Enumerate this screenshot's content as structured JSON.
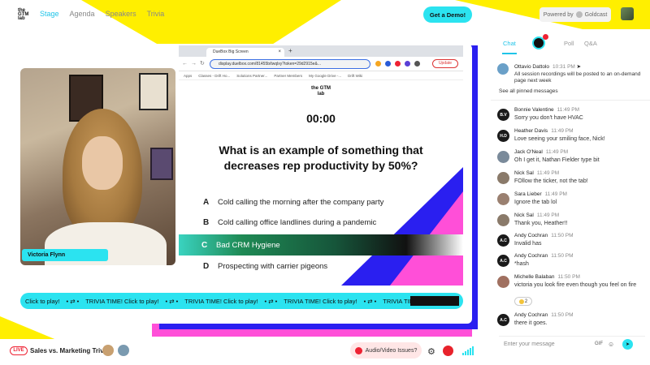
{
  "brand": {
    "logo_text": "the GTM lab",
    "accent": "#2be3f0",
    "pink": "#ff4fd8",
    "yellow": "#ffef00",
    "blue": "#2a1ff0"
  },
  "nav": {
    "items": [
      {
        "label": "Stage",
        "active": true
      },
      {
        "label": "Agenda",
        "active": false
      },
      {
        "label": "Speakers",
        "active": false
      },
      {
        "label": "Trivia",
        "active": false
      }
    ],
    "demo_button": "Get a Demo!",
    "powered_by": "Powered by",
    "powered_brand": "Goldcast"
  },
  "presenter": {
    "name": "Victoria Flynn"
  },
  "browser": {
    "tab_title": "DueBox Big Screen",
    "url": "display.duelbox.com/81455b/twqlxy?token=29d2915e&...",
    "update_label": "Update",
    "bookmarks": [
      "Apps",
      "Classes - Drift Ho...",
      "Solutions Partner...",
      "Partner Members",
      "My Google Drive -...",
      "Drift Wiki"
    ]
  },
  "trivia": {
    "logo": "the GTM lab",
    "timer": "00:00",
    "question": "What is an example of something that decreases rep productivity by 50%?",
    "answers": [
      {
        "letter": "A",
        "text": "Cold calling the morning after the company party"
      },
      {
        "letter": "B",
        "text": "Cold calling office landlines during a pandemic"
      },
      {
        "letter": "C",
        "text": "Bad CRM Hygiene"
      },
      {
        "letter": "D",
        "text": "Prospecting with carrier pigeons"
      }
    ]
  },
  "ticker": {
    "items": [
      "Click to play!",
      "TRIVIA TIME! Click to play!",
      "TRIVIA TIME! Click to play!",
      "TRIVIA TIME! Click to play!",
      "TRIVIA TIME!"
    ]
  },
  "bottom": {
    "live_label": "LIVE",
    "session_title": "Sales vs. Marketing Trivia",
    "av_issues": "Audio/Video Issues?"
  },
  "chat": {
    "tabs": [
      "Chat",
      "Poll",
      "Q&A"
    ],
    "pinned": {
      "name": "Ottavio Dattolo",
      "time": "10:31 PM",
      "text": "All session recordings will be posted to an on-demand page next week"
    },
    "see_pinned": "See all pinned messages",
    "messages": [
      {
        "initials": "B.V",
        "name": "Bonnie Valentine",
        "time": "11:49 PM",
        "text": "Sorry you don't have HVAC",
        "color": "#1a1a1a"
      },
      {
        "initials": "H.D",
        "name": "Heather Davis",
        "time": "11:49 PM",
        "text": "Love seeing your smiling face, Nick!",
        "color": "#1a1a1a"
      },
      {
        "initials": "",
        "name": "Jack O'Neal",
        "time": "11:49 PM",
        "text": "Oh I get it, Nathan Fielder type bit",
        "color": "#7a8a9a"
      },
      {
        "initials": "",
        "name": "Nick Sal",
        "time": "11:49 PM",
        "text": "FOllow the ticker, not the tab!",
        "color": "#8a7a6a"
      },
      {
        "initials": "",
        "name": "Sara Lieber",
        "time": "11:49 PM",
        "text": "Ignore the tab lol",
        "color": "#9a8070"
      },
      {
        "initials": "",
        "name": "Nick Sal",
        "time": "11:49 PM",
        "text": "Thank you, Heather!!",
        "color": "#8a7a6a"
      },
      {
        "initials": "A.C",
        "name": "Andy Cochran",
        "time": "11:50 PM",
        "text": "Invalid has",
        "color": "#1a1a1a"
      },
      {
        "initials": "A.C",
        "name": "Andy Cochran",
        "time": "11:50 PM",
        "text": "*hash",
        "color": "#1a1a1a"
      },
      {
        "initials": "",
        "name": "Michelle Balaban",
        "time": "11:50 PM",
        "text": "victoria you look fire even though you feel on fire",
        "color": "#a07060"
      },
      {
        "initials": "A.C",
        "name": "Andy Cochran",
        "time": "11:50 PM",
        "text": "there it goes.",
        "color": "#1a1a1a"
      }
    ],
    "reaction_count": "2",
    "input_placeholder": "Enter your message",
    "gif_label": "GIF"
  }
}
